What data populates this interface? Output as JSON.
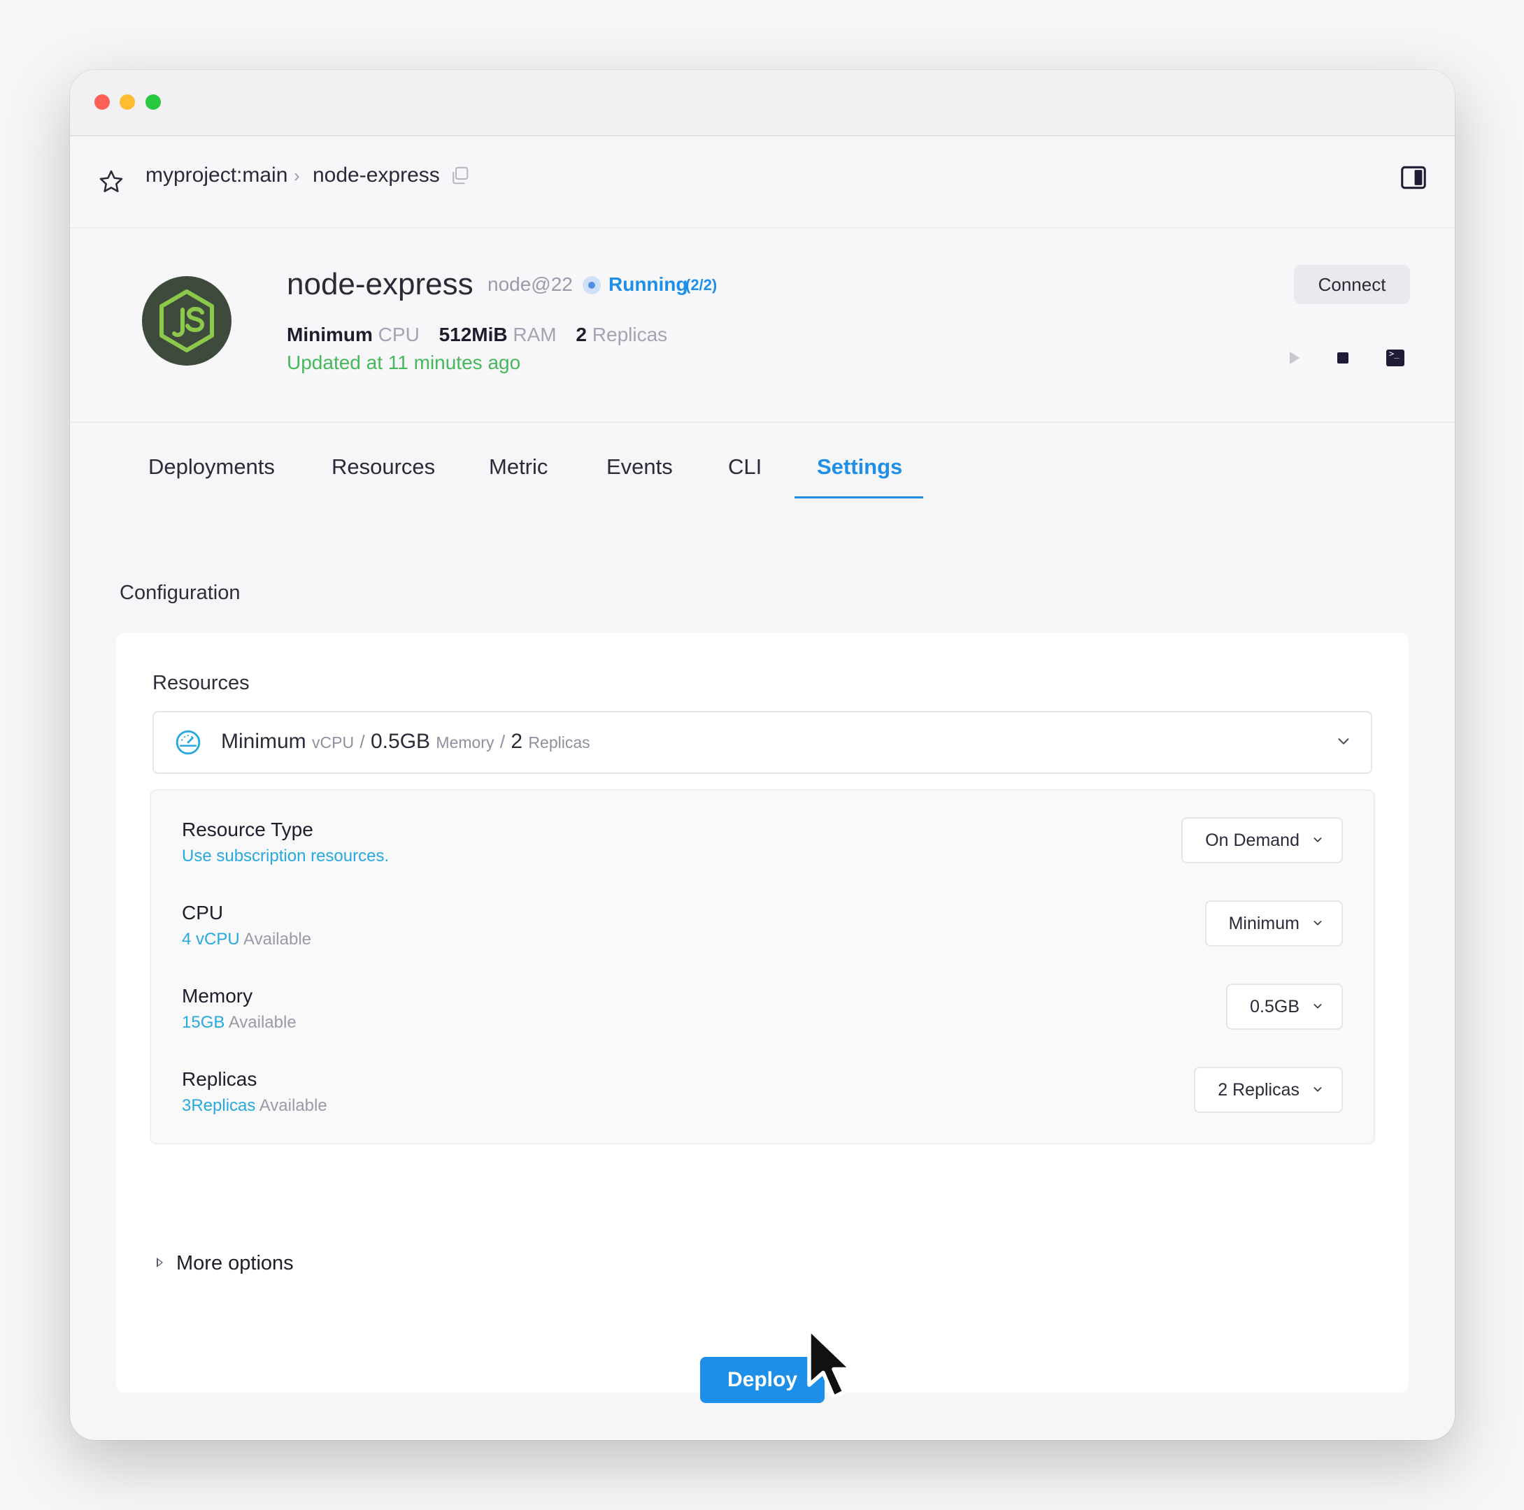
{
  "breadcrumb": {
    "project": "myproject:main",
    "separator": "›",
    "service": "node-express"
  },
  "service": {
    "name": "node-express",
    "image": "node@22",
    "status": "Running",
    "status_count": "(2/2)",
    "cpu_value": "Minimum",
    "cpu_unit": "CPU",
    "ram_value": "512MiB",
    "ram_unit": "RAM",
    "replicas_value": "2",
    "replicas_unit": "Replicas",
    "updated": "Updated at 11 minutes ago",
    "connect_label": "Connect"
  },
  "tabs": [
    {
      "label": "Deployments"
    },
    {
      "label": "Resources"
    },
    {
      "label": "Metric"
    },
    {
      "label": "Events"
    },
    {
      "label": "CLI"
    },
    {
      "label": "Settings",
      "active": true
    }
  ],
  "settings": {
    "section_title": "Configuration",
    "card_label": "Resources",
    "summary": {
      "cpu": "Minimum",
      "cpu_unit": "vCPU",
      "sep": "/",
      "memory": "0.5GB",
      "memory_unit": "Memory",
      "replicas": "2",
      "replicas_unit": "Replicas"
    },
    "rows": [
      {
        "title": "Resource Type",
        "sub_highlight": "Use subscription resources.",
        "sub_rest": "",
        "value": "On Demand"
      },
      {
        "title": "CPU",
        "sub_highlight": "4 vCPU",
        "sub_rest": " Available",
        "value": "Minimum"
      },
      {
        "title": "Memory",
        "sub_highlight": "15GB",
        "sub_rest": " Available",
        "value": "0.5GB"
      },
      {
        "title": "Replicas",
        "sub_highlight": "3Replicas",
        "sub_rest": " Available",
        "value": "2 Replicas"
      }
    ],
    "more_options": "More options",
    "deploy_label": "Deploy"
  },
  "colors": {
    "accent": "#1e8fe8",
    "success": "#45b85a",
    "link": "#28a8e0"
  },
  "icons": {
    "favorite": "star-icon",
    "copy": "copy-icon",
    "panel": "sidebar-toggle-icon",
    "start": "play-icon",
    "stop": "stop-icon",
    "terminal": "terminal-icon",
    "resources": "gauge-icon"
  }
}
